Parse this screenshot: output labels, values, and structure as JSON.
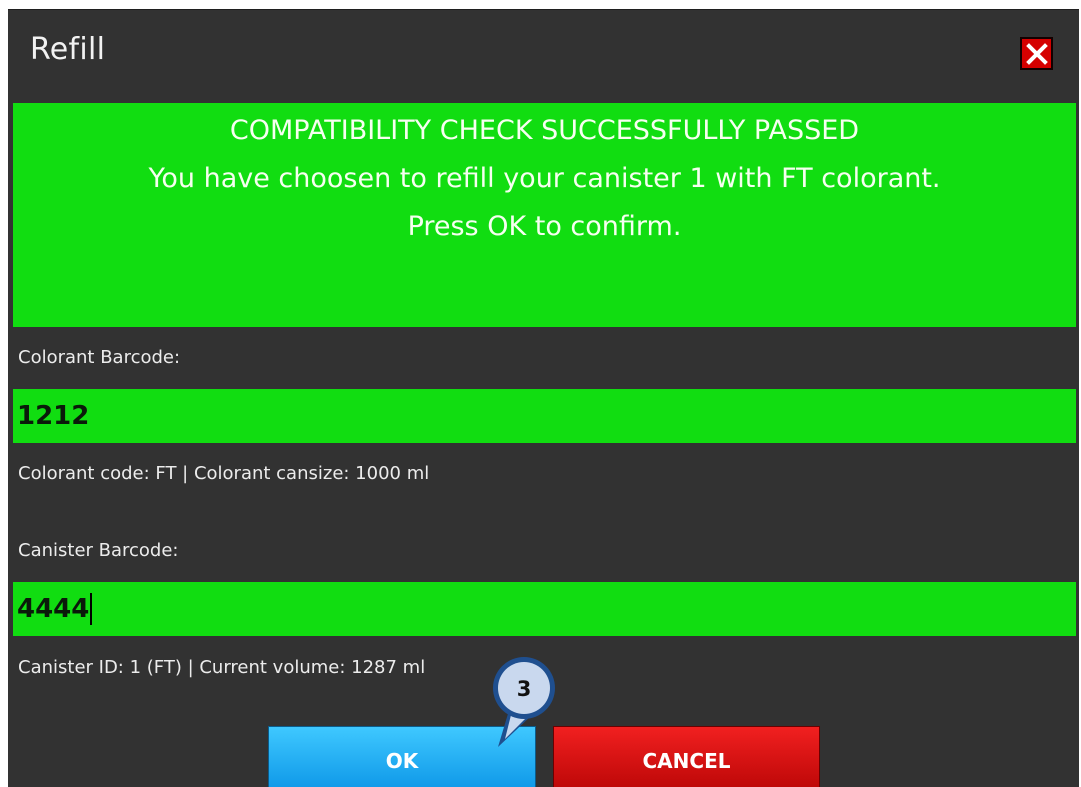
{
  "window": {
    "title": "Refill"
  },
  "banner": {
    "line1": "COMPATIBILITY CHECK SUCCESSFULLY PASSED",
    "line2": "You have choosen to refill your canister 1 with FT colorant.",
    "line3": "Press OK to confirm."
  },
  "colorant": {
    "label": "Colorant Barcode:",
    "value": "1212",
    "info": "Colorant code: FT  |  Colorant cansize: 1000 ml"
  },
  "canister": {
    "label": "Canister Barcode:",
    "value": "4444",
    "info": "Canister ID: 1 (FT) |  Current volume: 1287 ml"
  },
  "buttons": {
    "ok": "OK",
    "cancel": "CANCEL"
  },
  "step_marker": {
    "number": "3"
  },
  "colors": {
    "dialog_bg": "#323232",
    "success_green": "#11dd11",
    "ok_blue": "#0a94e6",
    "cancel_red": "#d50000"
  },
  "icons": {
    "close": "close-icon"
  }
}
